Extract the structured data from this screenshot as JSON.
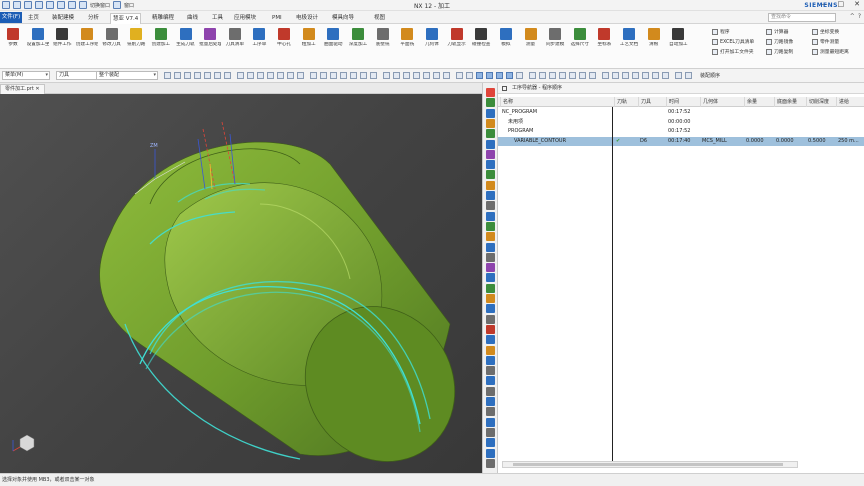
{
  "title_bar": {
    "app_title": "NX 12 - 加工",
    "quick_access_label": "切换窗口",
    "window_label": "窗口",
    "brand": "SIEMENS",
    "controls": [
      "—",
      "□",
      "✕"
    ]
  },
  "ribbon_tabs": {
    "file_tab": "文件(F)",
    "tabs": [
      "主页",
      "装配建模",
      "分析",
      "慧亚 V7.4",
      "精雕编程",
      "曲线",
      "工具",
      "应用模块",
      "PMI",
      "电极设计",
      "模具向导",
      "视图"
    ],
    "active_tab": "慧亚 V7.4",
    "search_placeholder": "查找命令"
  },
  "ribbon": {
    "groups": [
      {
        "label": "参数",
        "color": "#c0392b"
      },
      {
        "label": "设置加工坐标",
        "color": "#2e6fbf"
      },
      {
        "label": "组件工作",
        "color": "#3a3a3a"
      },
      {
        "label": "创建工序组",
        "color": "#d28a1d"
      },
      {
        "label": "修改刀具",
        "color": "#6d6d6d"
      },
      {
        "label": "铣削刀路",
        "color": "#e0b020"
      },
      {
        "label": "创建加工",
        "color": "#3c8d3c"
      },
      {
        "label": "生成刀轨",
        "color": "#2e6fbf"
      },
      {
        "label": "批量后处理",
        "color": "#8e44ad"
      },
      {
        "label": "刀具清单",
        "color": "#6d6d6d"
      },
      {
        "label": "工序单",
        "color": "#2e6fbf"
      },
      {
        "label": "中心孔",
        "color": "#c0392b"
      },
      {
        "label": "粗加工",
        "color": "#d28a1d"
      },
      {
        "label": "曲面驱动",
        "color": "#2e6fbf"
      },
      {
        "label": "深度加工",
        "color": "#3c8d3c"
      },
      {
        "label": "底壁铣",
        "color": "#6d6d6d"
      },
      {
        "label": "平面铣",
        "color": "#d28a1d"
      },
      {
        "label": "几何体",
        "color": "#2e6fbf"
      },
      {
        "label": "刀轨显示",
        "color": "#c0392b"
      },
      {
        "label": "碰撞检查",
        "color": "#3a3a3a"
      },
      {
        "label": "模拟",
        "color": "#2e6fbf"
      },
      {
        "label": "测量",
        "color": "#d28a1d"
      },
      {
        "label": "同步建模",
        "color": "#6d6d6d"
      },
      {
        "label": "选择尺寸",
        "color": "#3c8d3c"
      },
      {
        "label": "坐标系",
        "color": "#c0392b"
      },
      {
        "label": "工艺文档",
        "color": "#2e6fbf"
      },
      {
        "label": "清根",
        "color": "#d28a1d"
      },
      {
        "label": "自动加工",
        "color": "#3a3a3a"
      }
    ],
    "small_items": [
      "程序",
      "EXCEL刀具清单",
      "打开加工文件夹",
      "计算器",
      "刀路镜像",
      "刀路复制",
      "坐标变换",
      "零件测量",
      "测量最短距离"
    ]
  },
  "toolbar": {
    "menu_label": "菜单(M)",
    "selection_filter": "刀具",
    "assembly_filter": "整个装配",
    "snap_label": "装配顺序"
  },
  "doc_tab": {
    "label": "零件加工.prt"
  },
  "navigator": {
    "title": "工序导航器 - 程序顺序",
    "columns": [
      "名称",
      "刀轨",
      "刀具",
      "时间",
      "几何体",
      "余量",
      "底面余量",
      "切削深度",
      "进给"
    ],
    "rows": [
      {
        "name": "NC_PROGRAM",
        "path": "",
        "tool": "",
        "time": "00:17:52",
        "geom": "",
        "stock": "",
        "floor": "",
        "depth": "",
        "feed": "",
        "indent": 0
      },
      {
        "name": "未用项",
        "path": "",
        "tool": "",
        "time": "00:00:00",
        "geom": "",
        "stock": "",
        "floor": "",
        "depth": "",
        "feed": "",
        "indent": 1
      },
      {
        "name": "PROGRAM",
        "path": "",
        "tool": "",
        "time": "00:17:52",
        "geom": "",
        "stock": "",
        "floor": "",
        "depth": "",
        "feed": "",
        "indent": 1
      },
      {
        "name": "VARIABLE_CONTOUR",
        "path": "✔",
        "tool": "D6",
        "time": "00:17:40",
        "geom": "MCS_MILL",
        "stock": "0.0000",
        "floor": "0.0000",
        "depth": "0.5000",
        "feed": "250 m...",
        "indent": 2
      }
    ]
  },
  "status_bar": {
    "text": "选择对象并使用 MB3，或者双击某一对象"
  },
  "viewport": {
    "part_color": "#6f9c2c",
    "toolpath_color": "#3fe0d6",
    "axis_label": "ZM"
  }
}
